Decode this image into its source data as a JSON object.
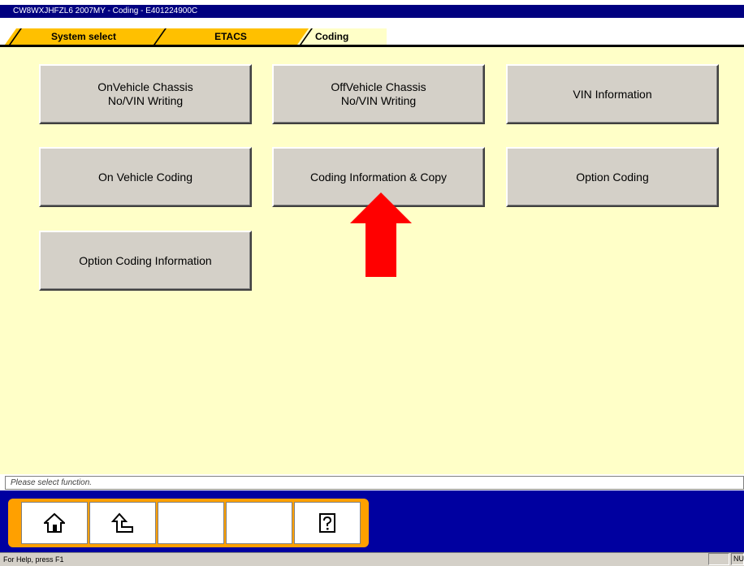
{
  "window": {
    "title": "CW8WXJHFZL6 2007MY   -  Coding  -  E401224900C"
  },
  "tabs": [
    {
      "label": "System select"
    },
    {
      "label": "ETACS"
    },
    {
      "label": "Coding"
    }
  ],
  "functions": [
    {
      "label": "OnVehicle Chassis\nNo/VIN Writing"
    },
    {
      "label": "OffVehicle Chassis\nNo/VIN Writing"
    },
    {
      "label": "VIN Information"
    },
    {
      "label": "On Vehicle Coding"
    },
    {
      "label": "Coding Information & Copy"
    },
    {
      "label": "Option Coding"
    },
    {
      "label": "Option Coding Information"
    }
  ],
  "annotation": {
    "arrow_color": "#ff0000",
    "points_to": "Coding Information & Copy"
  },
  "message": "Please select function.",
  "toolbar": {
    "buttons": [
      {
        "icon": "home-icon"
      },
      {
        "icon": "back-icon"
      },
      {
        "icon": ""
      },
      {
        "icon": ""
      },
      {
        "icon": "help-icon"
      }
    ]
  },
  "statusbar": {
    "text": "For Help, press F1",
    "indicator": "NUM"
  },
  "colors": {
    "title_bg": "#000080",
    "tab_active": "#ffc000",
    "content_bg": "#ffffc8",
    "toolbar_bg": "#0000a0",
    "toolbar_accent": "#ffa000"
  }
}
